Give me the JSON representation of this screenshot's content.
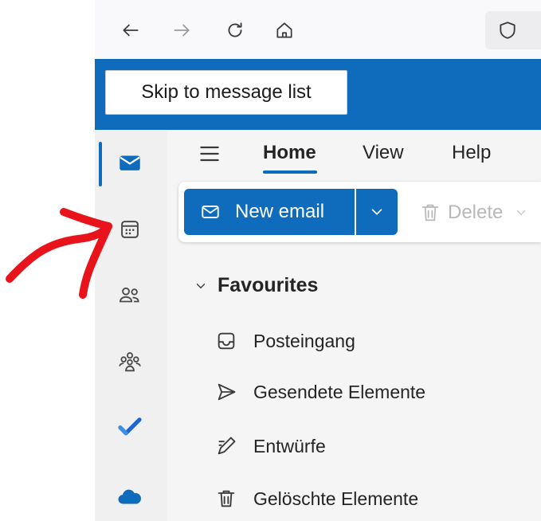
{
  "browser": {
    "icons": [
      "back-arrow-icon",
      "forward-arrow-icon",
      "reload-icon",
      "home-icon",
      "shield-icon"
    ]
  },
  "skip_link": {
    "label": "Skip to message list"
  },
  "nav_tabs": [
    {
      "label": "Home",
      "active": true
    },
    {
      "label": "View",
      "active": false
    },
    {
      "label": "Help",
      "active": false
    }
  ],
  "rail": {
    "items": [
      "mail-icon",
      "calendar-icon",
      "people-icon",
      "groups-icon",
      "todo-icon",
      "onedrive-icon"
    ],
    "active": "mail-icon"
  },
  "toolbar": {
    "new_email_label": "New email",
    "delete_label": "Delete"
  },
  "favourites": {
    "header": "Favourites",
    "items": [
      {
        "label": "Posteingang",
        "icon": "inbox-icon"
      },
      {
        "label": "Gesendete Elemente",
        "icon": "sent-icon"
      },
      {
        "label": "Entwürfe",
        "icon": "drafts-icon"
      },
      {
        "label": "Gelöschte Elemente",
        "icon": "trash-icon"
      }
    ]
  },
  "colors": {
    "brand": "#0f6cbd",
    "annotation": "#e8131b"
  }
}
